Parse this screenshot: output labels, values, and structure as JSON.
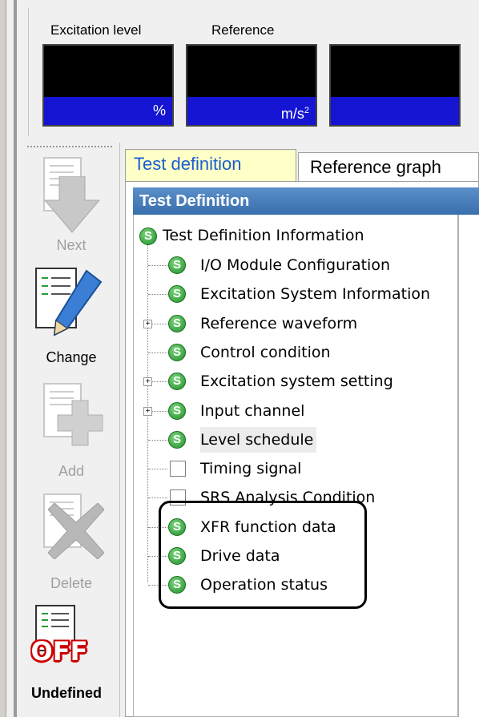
{
  "meters": {
    "labels": [
      "Excitation level",
      "Reference"
    ],
    "units": [
      "%",
      "m/s",
      ""
    ],
    "unit_superscript": "2"
  },
  "toolbar": {
    "next": "Next",
    "change": "Change",
    "add": "Add",
    "delete": "Delete",
    "undefined": "Undefined",
    "off_badge": "OFF"
  },
  "tabs": {
    "active": "Test definition",
    "reference": "Reference graph"
  },
  "panel": {
    "header": "Test Definition"
  },
  "tree": {
    "root": "Test Definition Information",
    "items": [
      "I/O Module Configuration",
      "Excitation System Information",
      "Reference waveform",
      "Control condition",
      "Excitation system setting",
      "Input channel",
      "Level schedule",
      "Timing signal",
      "SRS Analysis Condition",
      "XFR function data",
      "Drive data",
      "Operation status"
    ],
    "icon_letter": "S"
  },
  "colors": {
    "meter_unit_bg": "#1414d2",
    "tab_active_bg": "#ffffc8",
    "header_blue": "#3a6fae",
    "status_green": "#1f8f2a"
  }
}
